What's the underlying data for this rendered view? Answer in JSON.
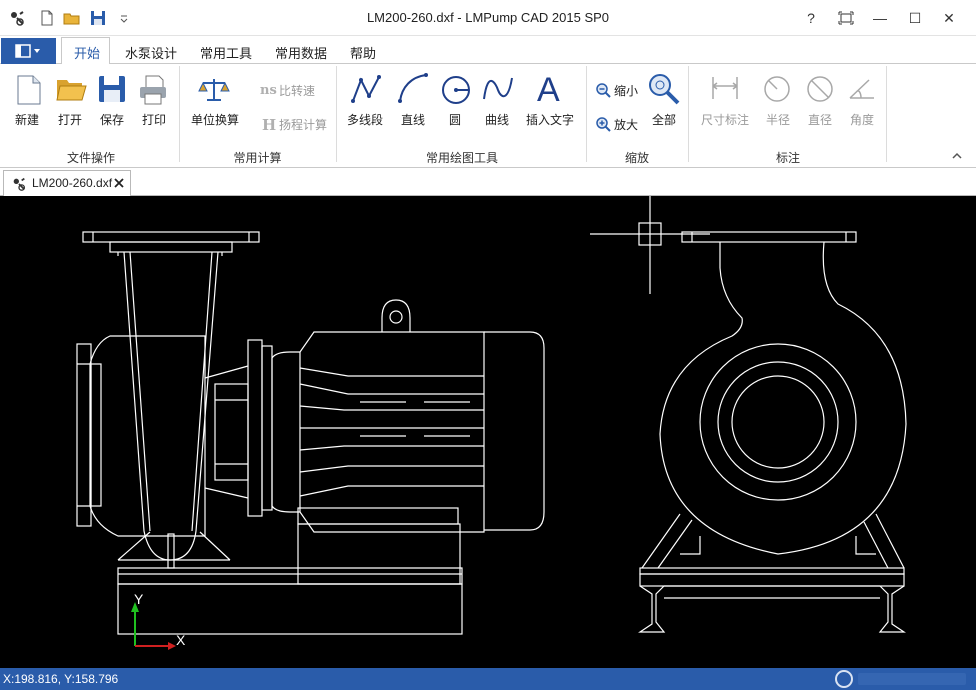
{
  "app": {
    "title": "LM200-260.dxf - LMPump CAD 2015 SP0"
  },
  "window_controls": {
    "help": "?",
    "minimize": "—",
    "maximize": "☐",
    "close": "✕"
  },
  "tabs": [
    {
      "label": "开始"
    },
    {
      "label": "水泵设计"
    },
    {
      "label": "常用工具"
    },
    {
      "label": "常用数据"
    },
    {
      "label": "帮助"
    }
  ],
  "ribbon": {
    "groups": [
      {
        "label": "文件操作"
      },
      {
        "label": "常用计算"
      },
      {
        "label": "常用绘图工具"
      },
      {
        "label": "缩放"
      },
      {
        "label": "标注"
      }
    ],
    "file": {
      "new": "新建",
      "open": "打开",
      "save": "保存",
      "print": "打印"
    },
    "calc": {
      "unit": "单位换算",
      "ns": "比转速",
      "head": "扬程计算"
    },
    "draw": {
      "polyline": "多线段",
      "line": "直线",
      "circle": "圆",
      "curve": "曲线",
      "text": "插入文字"
    },
    "zoom": {
      "out": "缩小",
      "in": "放大",
      "all": "全部"
    },
    "dim": {
      "size": "尺寸标注",
      "radius": "半径",
      "diameter": "直径",
      "angle": "角度"
    }
  },
  "document_tab": {
    "label": "LM200-260.dxf"
  },
  "axes": {
    "x": "X",
    "y": "Y"
  },
  "status": {
    "coords": "X:198.816, Y:158.796"
  },
  "colors": {
    "accent": "#2a5caa",
    "canvas": "#000000",
    "cad_line": "#ffffff",
    "axis_x": "#d02020",
    "axis_y": "#20c020"
  }
}
